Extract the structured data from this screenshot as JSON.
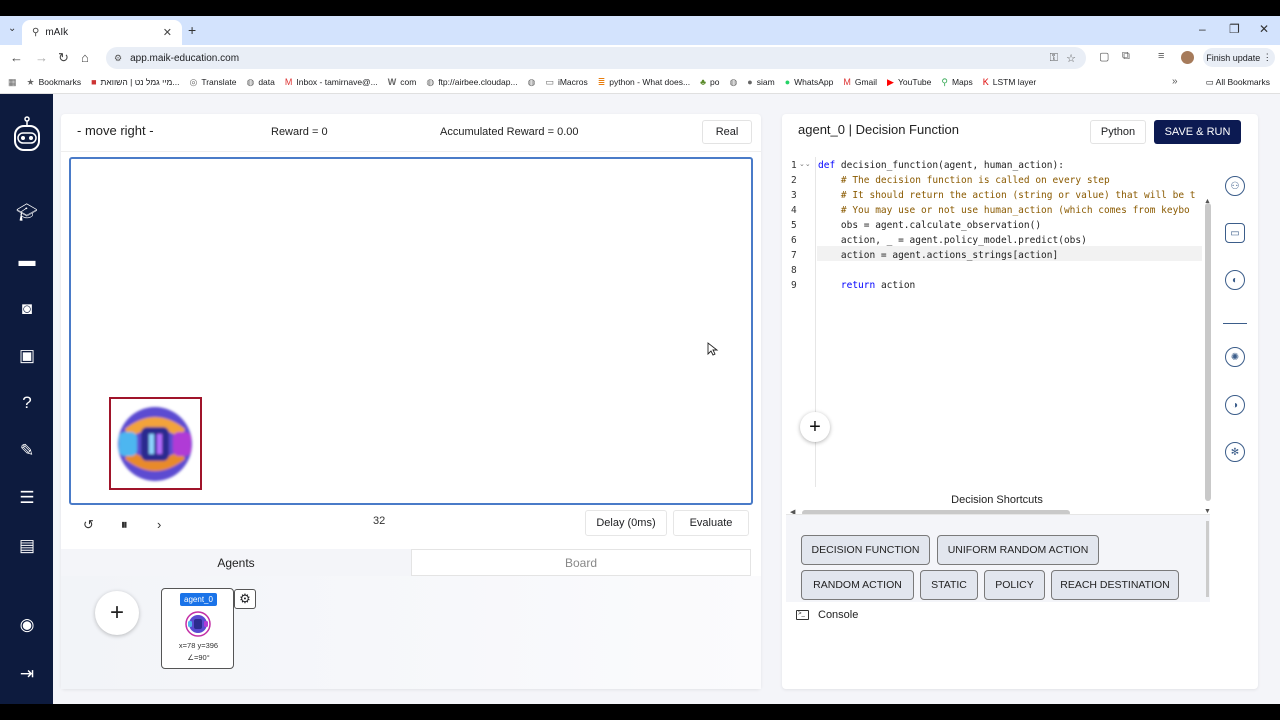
{
  "browser": {
    "tab_title": "mAIk",
    "url": "app.maik-education.com",
    "finish_update": "Finish update",
    "bookmarks": [
      {
        "label": "Bookmarks",
        "icon": "star-icon"
      },
      {
        "label": "מיי גמל נט | השוואת...",
        "icon": "bookmark-icon"
      },
      {
        "label": "Translate",
        "icon": "translate-icon"
      },
      {
        "label": "data",
        "icon": "globe-icon"
      },
      {
        "label": "Inbox - tamirnave@...",
        "icon": "gmail-icon"
      },
      {
        "label": "com",
        "icon": "wiki-icon"
      },
      {
        "label": "ftp://airbee.cloudap...",
        "icon": "globe-icon"
      },
      {
        "label": "",
        "icon": "globe-icon"
      },
      {
        "label": "iMacros",
        "icon": "folder-icon"
      },
      {
        "label": "python - What does...",
        "icon": "so-icon"
      },
      {
        "label": "po",
        "icon": "bookmark-icon"
      },
      {
        "label": "",
        "icon": "globe-icon"
      },
      {
        "label": "siam",
        "icon": "github-icon"
      },
      {
        "label": "WhatsApp",
        "icon": "whatsapp-icon"
      },
      {
        "label": "Gmail",
        "icon": "gmail-icon"
      },
      {
        "label": "YouTube",
        "icon": "youtube-icon"
      },
      {
        "label": "Maps",
        "icon": "maps-icon"
      },
      {
        "label": "LSTM layer",
        "icon": "keras-icon"
      }
    ],
    "all_bookmarks": "All Bookmarks"
  },
  "sim": {
    "action_label": "- move right -",
    "reward": "Reward = 0",
    "accumulated_reward": "Accumulated Reward = 0.00",
    "real_button": "Real",
    "step": "32",
    "delay_button": "Delay (0ms)",
    "evaluate_button": "Evaluate"
  },
  "tabs": {
    "agents": "Agents",
    "board": "Board"
  },
  "agent_card": {
    "name": "agent_0",
    "coords": "x=78 y=396",
    "angle": "∠=90°"
  },
  "editor": {
    "title": "agent_0 | Decision Function",
    "python_button": "Python",
    "save_run_button": "SAVE & RUN",
    "line_numbers": [
      "1",
      "2",
      "3",
      "4",
      "5",
      "6",
      "7",
      "8",
      "9"
    ],
    "lines": [
      "def decision_function(agent, human_action):",
      "    # The decision function is called on every step",
      "    # It should return the action (string or value) that will be t",
      "    # You may use or not use human_action (which comes from keybo",
      "    obs = agent.calculate_observation()",
      "    action, _ = agent.policy_model.predict(obs)",
      "    action = agent.actions_strings[action]",
      "",
      "    return action"
    ]
  },
  "shortcuts": {
    "title": "Decision Shortcuts",
    "buttons": [
      "DECISION FUNCTION",
      "UNIFORM RANDOM ACTION",
      "RANDOM ACTION",
      "STATIC",
      "POLICY",
      "REACH DESTINATION"
    ]
  },
  "console": {
    "label": "Console"
  },
  "colors": {
    "sidebar": "#0d1b3e",
    "save_button": "#0c1a52",
    "canvas_border": "#4a7bc8",
    "agent_border": "#a0142a",
    "agent_tag": "#1a73e8"
  }
}
